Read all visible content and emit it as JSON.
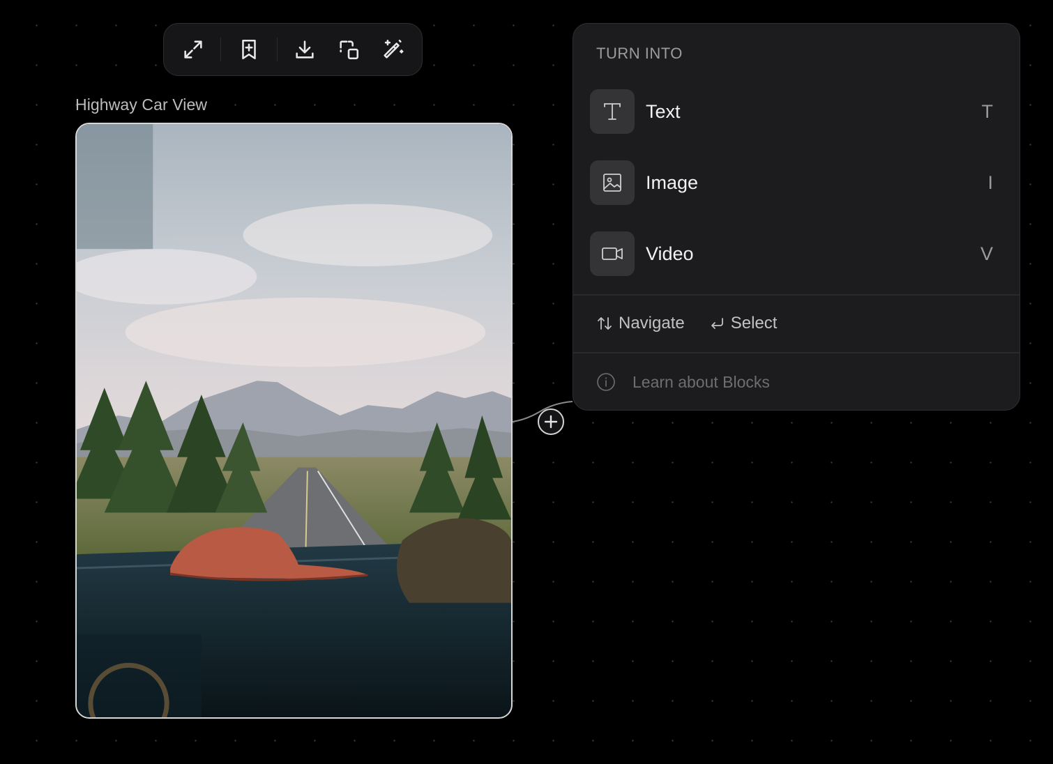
{
  "toolbar": {
    "buttons": [
      {
        "name": "expand-icon"
      },
      {
        "name": "bookmark-add-icon"
      },
      {
        "name": "download-icon"
      },
      {
        "name": "duplicate-icon"
      },
      {
        "name": "magic-wand-icon"
      }
    ]
  },
  "node": {
    "title": "Highway Car View",
    "image_description": "photo"
  },
  "panel": {
    "heading": "TURN INTO",
    "items": [
      {
        "label": "Text",
        "shortcut": "T",
        "icon": "text-icon"
      },
      {
        "label": "Image",
        "shortcut": "I",
        "icon": "image-icon"
      },
      {
        "label": "Video",
        "shortcut": "V",
        "icon": "video-icon"
      }
    ],
    "hints": [
      {
        "label": "Navigate",
        "icon": "arrows-updown-icon"
      },
      {
        "label": "Select",
        "icon": "return-icon"
      }
    ],
    "learn_link": "Learn about Blocks"
  },
  "colors": {
    "background": "#000000",
    "panel": "#1c1c1e",
    "icon_box": "#343437"
  }
}
